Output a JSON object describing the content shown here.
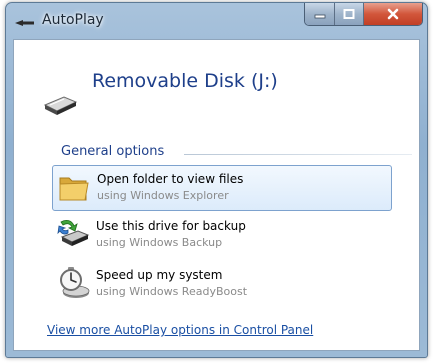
{
  "window": {
    "title": "AutoPlay",
    "title_icon": "drive-arrow-icon",
    "buttons": {
      "minimize": "minimize-icon",
      "maximize": "maximize-icon",
      "close": "close-icon"
    }
  },
  "drive": {
    "name": "Removable Disk (J:)",
    "icon": "removable-drive-icon"
  },
  "section": {
    "label": "General options"
  },
  "options": [
    {
      "title": "Open folder to view files",
      "subtitle": "using Windows Explorer",
      "icon": "folder-icon",
      "selected": true
    },
    {
      "title": "Use this drive for backup",
      "subtitle": "using Windows Backup",
      "icon": "backup-icon",
      "selected": false
    },
    {
      "title": "Speed up my system",
      "subtitle": "using Windows ReadyBoost",
      "icon": "stopwatch-icon",
      "selected": false
    }
  ],
  "more_link": "View more AutoPlay options in Control Panel",
  "colors": {
    "accent_text": "#1e3f8a",
    "link": "#1a4fa3",
    "selection_border": "#7da2ce",
    "close_button": "#c13f25"
  }
}
